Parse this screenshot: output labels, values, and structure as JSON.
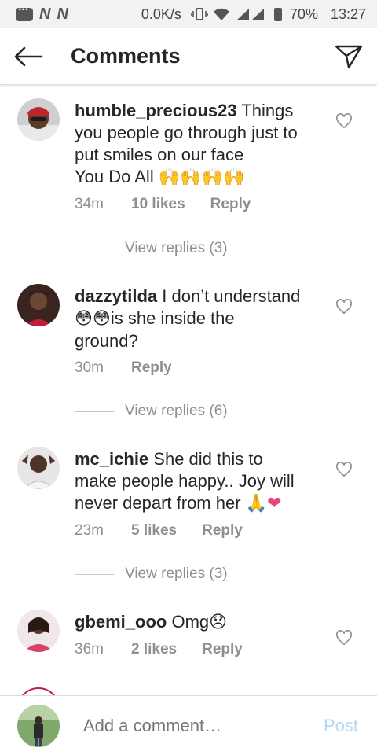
{
  "status_bar": {
    "carrier_1": "N",
    "carrier_2": "N",
    "speed": "0.0K/s",
    "battery": "70%",
    "time": "13:27",
    "icons": [
      "message-icon",
      "vibrate-icon",
      "wifi-icon",
      "signal-icon",
      "battery-icon"
    ]
  },
  "header": {
    "title": "Comments",
    "back_icon": "arrow-left-icon",
    "direct_icon": "paper-plane-icon"
  },
  "comments": [
    {
      "username": "humble_precious23",
      "text_lines": [
        "Things",
        "you people go through just to",
        "put smiles on our face",
        "You Do All"
      ],
      "emoji": "🙌🙌🙌🙌",
      "time": "34m",
      "likes": "10 likes",
      "reply": "Reply",
      "view_replies": "View replies (3)"
    },
    {
      "username": "dazzytilda",
      "text_lines": [
        "I don’t understand",
        "is she inside the",
        "ground?"
      ],
      "emoji": "😳😳",
      "time": "30m",
      "likes": "",
      "reply": "Reply",
      "view_replies": "View replies (6)"
    },
    {
      "username": "mc_ichie",
      "text_lines": [
        "She did this to",
        "make people happy.. Joy will",
        "never depart from her"
      ],
      "emoji": "🙏❤",
      "time": "23m",
      "likes": "5 likes",
      "reply": "Reply",
      "view_replies": "View replies (3)"
    },
    {
      "username": "gbemi_ooo",
      "text_lines": [
        "Omg"
      ],
      "emoji": "😞",
      "time": "36m",
      "likes": "2 likes",
      "reply": "Reply"
    }
  ],
  "composer": {
    "placeholder": "Add a comment…",
    "post_label": "Post"
  },
  "colors": {
    "text": "#262626",
    "meta": "#8e8e8e",
    "post_disabled": "#b3d7f5"
  }
}
